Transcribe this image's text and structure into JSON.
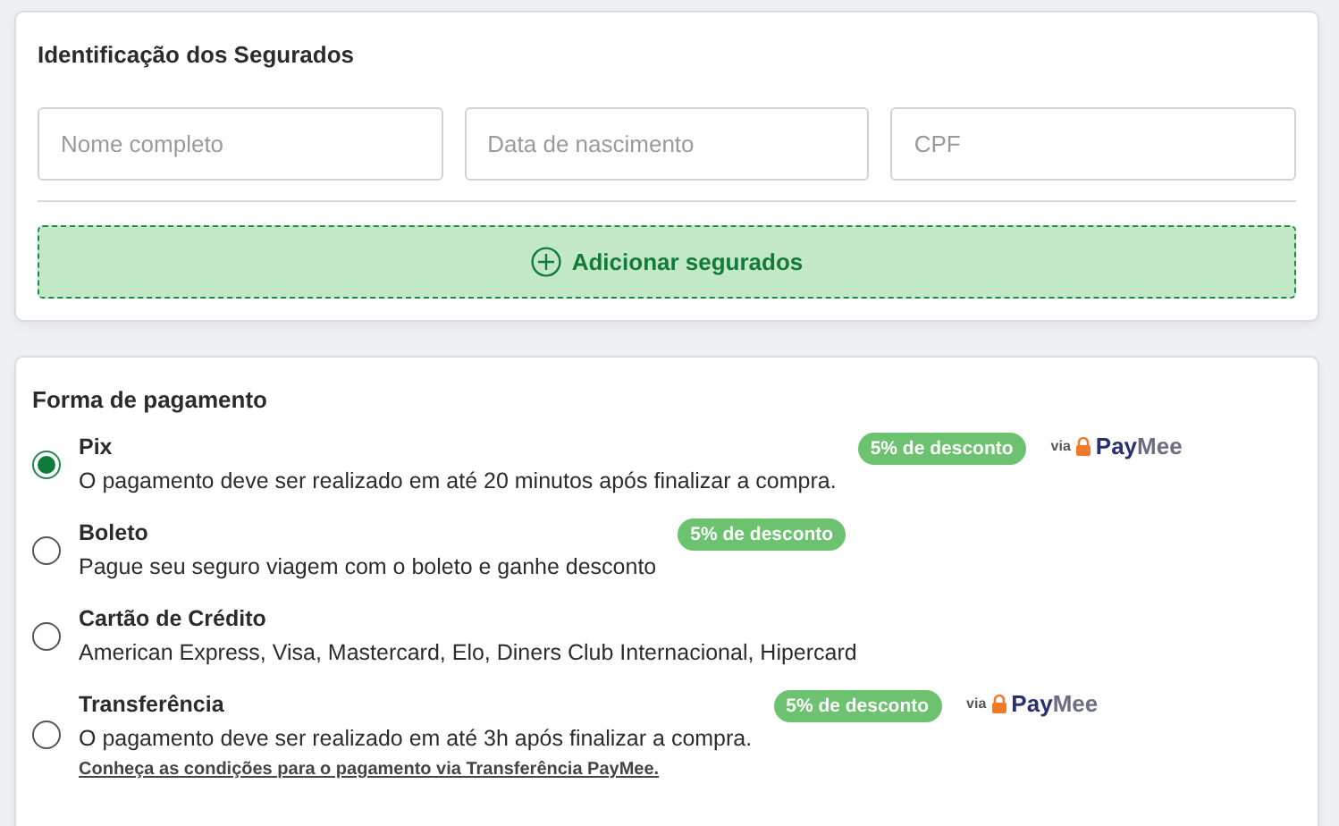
{
  "insured_section": {
    "title": "Identificação dos Segurados",
    "fields": [
      {
        "placeholder": "Nome completo"
      },
      {
        "placeholder": "Data de nascimento"
      },
      {
        "placeholder": "CPF"
      }
    ],
    "add_button": "Adicionar segurados"
  },
  "payment_section": {
    "title": "Forma de pagamento",
    "options": [
      {
        "title": "Pix",
        "description": "O pagamento deve ser realizado em até 20 minutos após finalizar a compra.",
        "selected": true,
        "badge": "5% de desconto",
        "provider": {
          "prefix": "via",
          "name_part_1": "Pay",
          "name_part_2": "Mee"
        }
      },
      {
        "title": "Boleto",
        "description": "Pague seu seguro viagem com o boleto e ganhe desconto",
        "selected": false,
        "badge": "5% de desconto"
      },
      {
        "title": "Cartão de Crédito",
        "description": "American Express, Visa, Mastercard, Elo, Diners Club Internacional, Hipercard",
        "selected": false
      },
      {
        "title": "Transferência",
        "description": "O pagamento deve ser realizado em até 3h após finalizar a compra.",
        "selected": false,
        "badge": "5% de desconto",
        "provider": {
          "prefix": "via",
          "name_part_1": "Pay",
          "name_part_2": "Mee"
        },
        "link": "Conheça as condições para o pagamento via Transferência PayMee."
      }
    ]
  }
}
